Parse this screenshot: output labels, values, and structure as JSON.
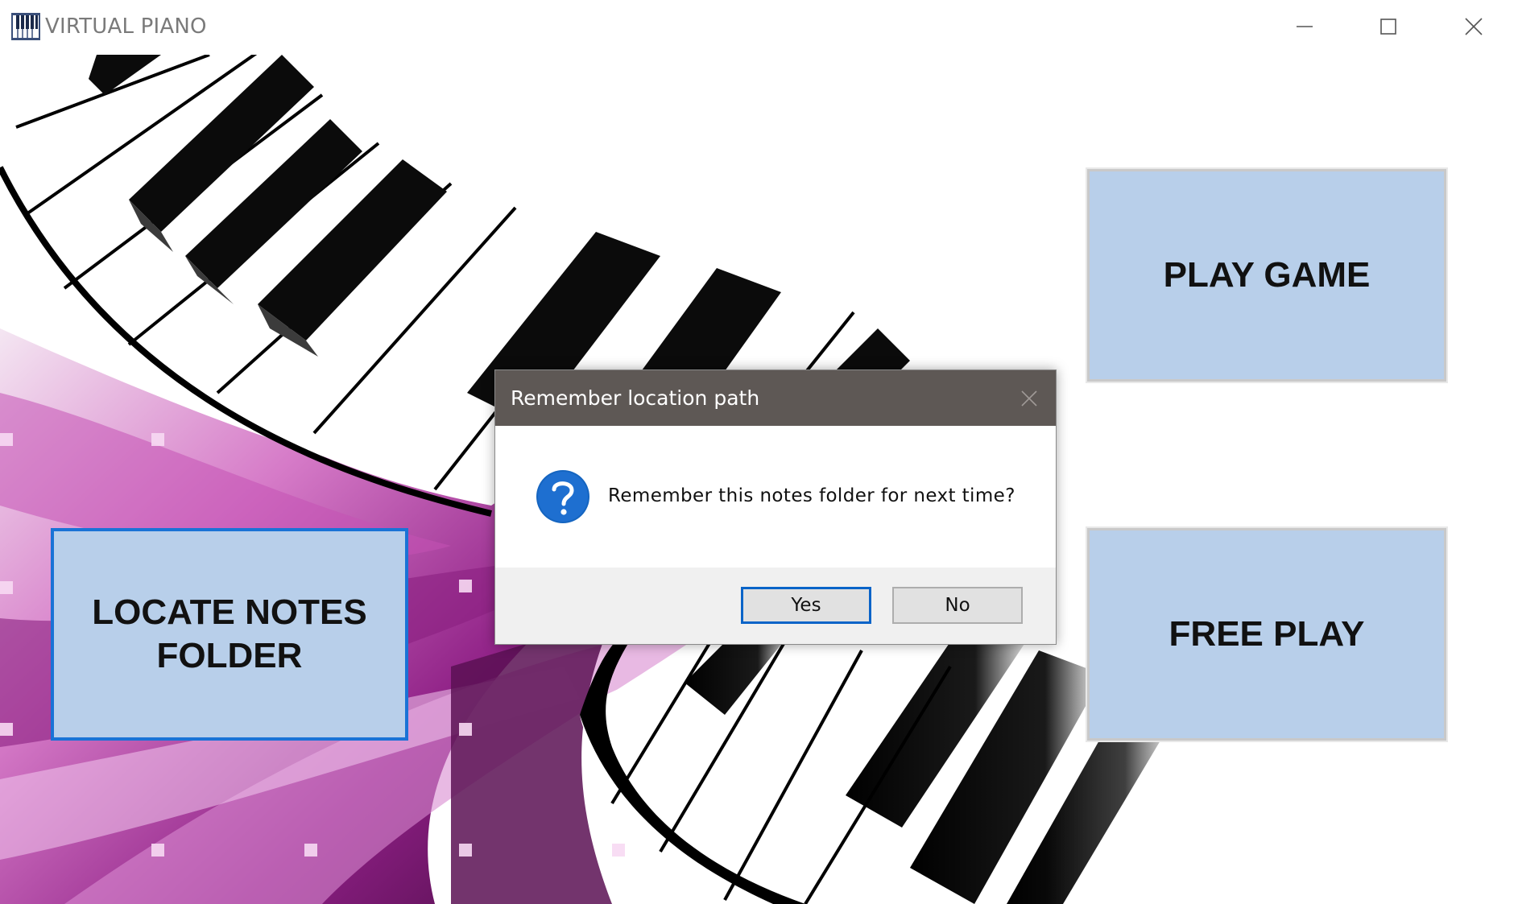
{
  "window": {
    "title": "VIRTUAL PIANO"
  },
  "menu": {
    "play_game_label": "PLAY GAME",
    "free_play_label": "FREE PLAY",
    "locate_notes_line1": "LOCATE NOTES",
    "locate_notes_line2": "FOLDER"
  },
  "dialog": {
    "title": "Remember location path",
    "message": "Remember this notes folder for next time?",
    "yes_label": "Yes",
    "no_label": "No",
    "icon": "question-icon"
  },
  "colors": {
    "menu_button_bg": "#b8cfea",
    "focus_border": "#1a73d6",
    "dialog_title_bg": "#5e5855",
    "accent_purple": "#a0308f"
  },
  "icons": [
    "piano-icon",
    "minimize-icon",
    "maximize-icon",
    "close-icon",
    "question-icon"
  ]
}
